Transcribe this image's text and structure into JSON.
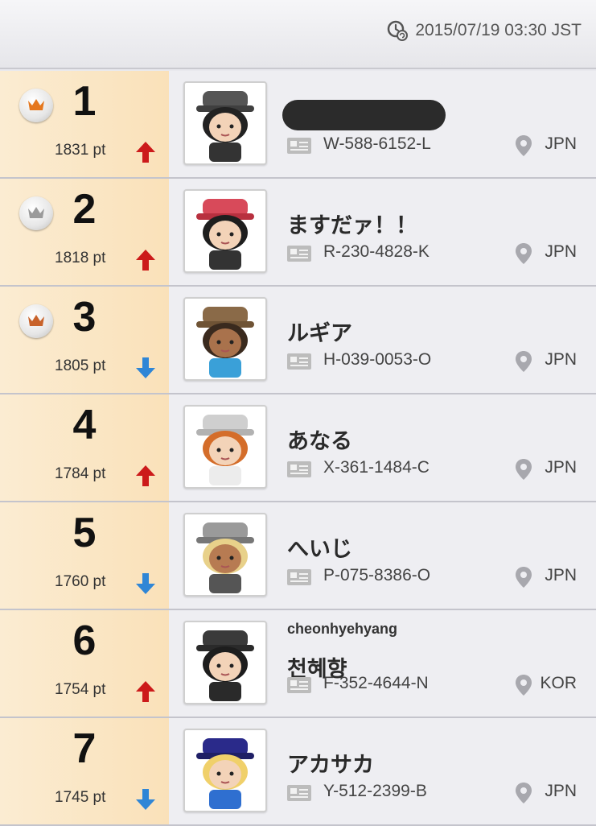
{
  "header": {
    "timestamp": "2015/07/19 03:30 JST",
    "icon": "clock-refresh-icon"
  },
  "colors": {
    "rank_cell": "#fae1b9",
    "trend_up": "#cc1a1a",
    "trend_down": "#2f86d6",
    "crown_gold": "#e5781f",
    "crown_silver": "#9a9a9a",
    "crown_bronze": "#c8622a"
  },
  "rankings": [
    {
      "rank": "1",
      "points": "1831 pt",
      "trend": "up",
      "crown": "gold",
      "name": "",
      "subname": "",
      "name_redacted": true,
      "id": "W-588-6152-L",
      "country": "JPN"
    },
    {
      "rank": "2",
      "points": "1818 pt",
      "trend": "up",
      "crown": "silver",
      "name": "ますだァ！！",
      "subname": "",
      "name_redacted": false,
      "id": "R-230-4828-K",
      "country": "JPN"
    },
    {
      "rank": "3",
      "points": "1805 pt",
      "trend": "down",
      "crown": "bronze",
      "name": "ルギア",
      "subname": "",
      "name_redacted": false,
      "id": "H-039-0053-O",
      "country": "JPN"
    },
    {
      "rank": "4",
      "points": "1784 pt",
      "trend": "up",
      "crown": "",
      "name": "あなる",
      "subname": "",
      "name_redacted": false,
      "id": "X-361-1484-C",
      "country": "JPN"
    },
    {
      "rank": "5",
      "points": "1760 pt",
      "trend": "down",
      "crown": "",
      "name": "へいじ",
      "subname": "",
      "name_redacted": false,
      "id": "P-075-8386-O",
      "country": "JPN"
    },
    {
      "rank": "6",
      "points": "1754 pt",
      "trend": "up",
      "crown": "",
      "name": "천혜향",
      "subname": "cheonhyehyang",
      "name_redacted": false,
      "id": "F-352-4644-N",
      "country": "KOR"
    },
    {
      "rank": "7",
      "points": "1745 pt",
      "trend": "down",
      "crown": "",
      "name": "アカサカ",
      "subname": "",
      "name_redacted": false,
      "id": "Y-512-2399-B",
      "country": "JPN"
    }
  ]
}
